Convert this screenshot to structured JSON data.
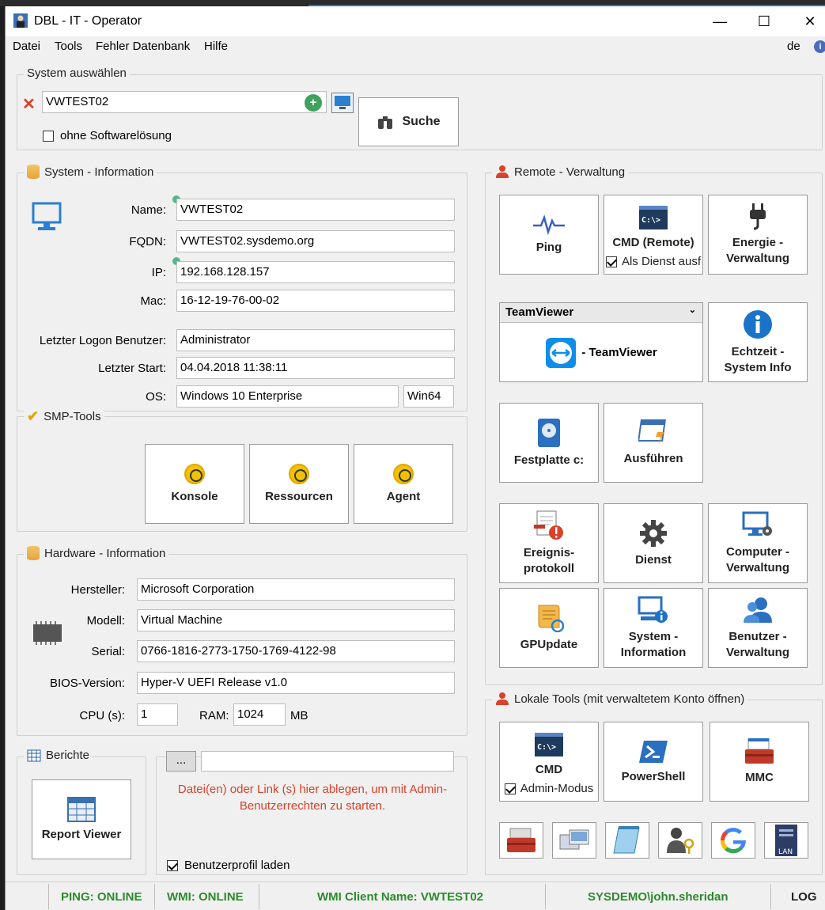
{
  "window": {
    "title": "DBL - IT - Operator",
    "minimize": "—",
    "maximize": "☐",
    "close": "✕"
  },
  "menu": {
    "items": [
      "Datei",
      "Tools",
      "Fehler Datenbank",
      "Hilfe"
    ],
    "lang": "de"
  },
  "system_select": {
    "group_title": "System auswählen",
    "input_value": "VWTEST02",
    "checkbox_label": "ohne Softwarelösung",
    "search_label": "Suche"
  },
  "system_info": {
    "group_title": "System - Information",
    "name_label": "Name:",
    "name": "VWTEST02",
    "fqdn_label": "FQDN:",
    "fqdn": "VWTEST02.sysdemo.org",
    "ip_label": "IP:",
    "ip": "192.168.128.157",
    "mac_label": "Mac:",
    "mac": "16-12-19-76-00-02",
    "logon_label": "Letzter Logon Benutzer:",
    "logon": "Administrator",
    "start_label": "Letzter Start:",
    "start": "04.04.2018 11:38:11",
    "os_label": "OS:",
    "os": "Windows 10 Enterprise",
    "arch": "Win64"
  },
  "smp": {
    "group_title": "SMP-Tools",
    "buttons": [
      "Konsole",
      "Ressourcen",
      "Agent"
    ]
  },
  "hardware": {
    "group_title": "Hardware - Information",
    "vendor_label": "Hersteller:",
    "vendor": "Microsoft Corporation",
    "model_label": "Modell:",
    "model": "Virtual Machine",
    "serial_label": "Serial:",
    "serial": "0766-1816-2773-1750-1769-4122-98",
    "bios_label": "BIOS-Version:",
    "bios": "Hyper-V UEFI Release v1.0",
    "cpu_label": "CPU (s):",
    "cpu": "1",
    "ram_label": "RAM:",
    "ram": "1024",
    "ram_unit": "MB"
  },
  "reports": {
    "group_title": "Berichte",
    "button": "Report Viewer"
  },
  "dropzone": {
    "browse": "...",
    "message": "Datei(en) oder Link (s) hier ablegen, um mit Admin-Benutzerrechten zu starten.",
    "checkbox_label": "Benutzerprofil laden"
  },
  "remote": {
    "group_title": "Remote - Verwaltung",
    "ping": "Ping",
    "cmd_remote": "CMD (Remote)",
    "cmd_service": "Als Dienst ausf",
    "energy": "Energie - Verwaltung",
    "teamviewer_select": "TeamViewer",
    "teamviewer_btn": "- TeamViewer",
    "realtime": "Echtzeit - System Info",
    "disk": "Festplatte c:",
    "run": "Ausführen",
    "events": "Ereignis-protokoll",
    "service": "Dienst",
    "computer_mgmt": "Computer - Verwaltung",
    "gpupdate": "GPUpdate",
    "sysinfo": "System - Information",
    "users": "Benutzer - Verwaltung"
  },
  "local": {
    "group_title": "Lokale Tools (mit verwaltetem Konto öffnen)",
    "cmd": "CMD",
    "admin_mode": "Admin-Modus",
    "powershell": "PowerShell",
    "mmc": "MMC",
    "cmd_icon_text": "C:\\>",
    "lan_icon_text": "LAN"
  },
  "status": {
    "ping": "PING: ONLINE",
    "wmi": "WMI: ONLINE",
    "wmi_client": "WMI Client Name: VWTEST02",
    "user": "SYSDEMO\\john.sheridan",
    "log": "LOG"
  },
  "colors": {
    "online_green": "#2e8a2e",
    "drop_red": "#d9412a",
    "accent_blue": "#1a73c9"
  }
}
